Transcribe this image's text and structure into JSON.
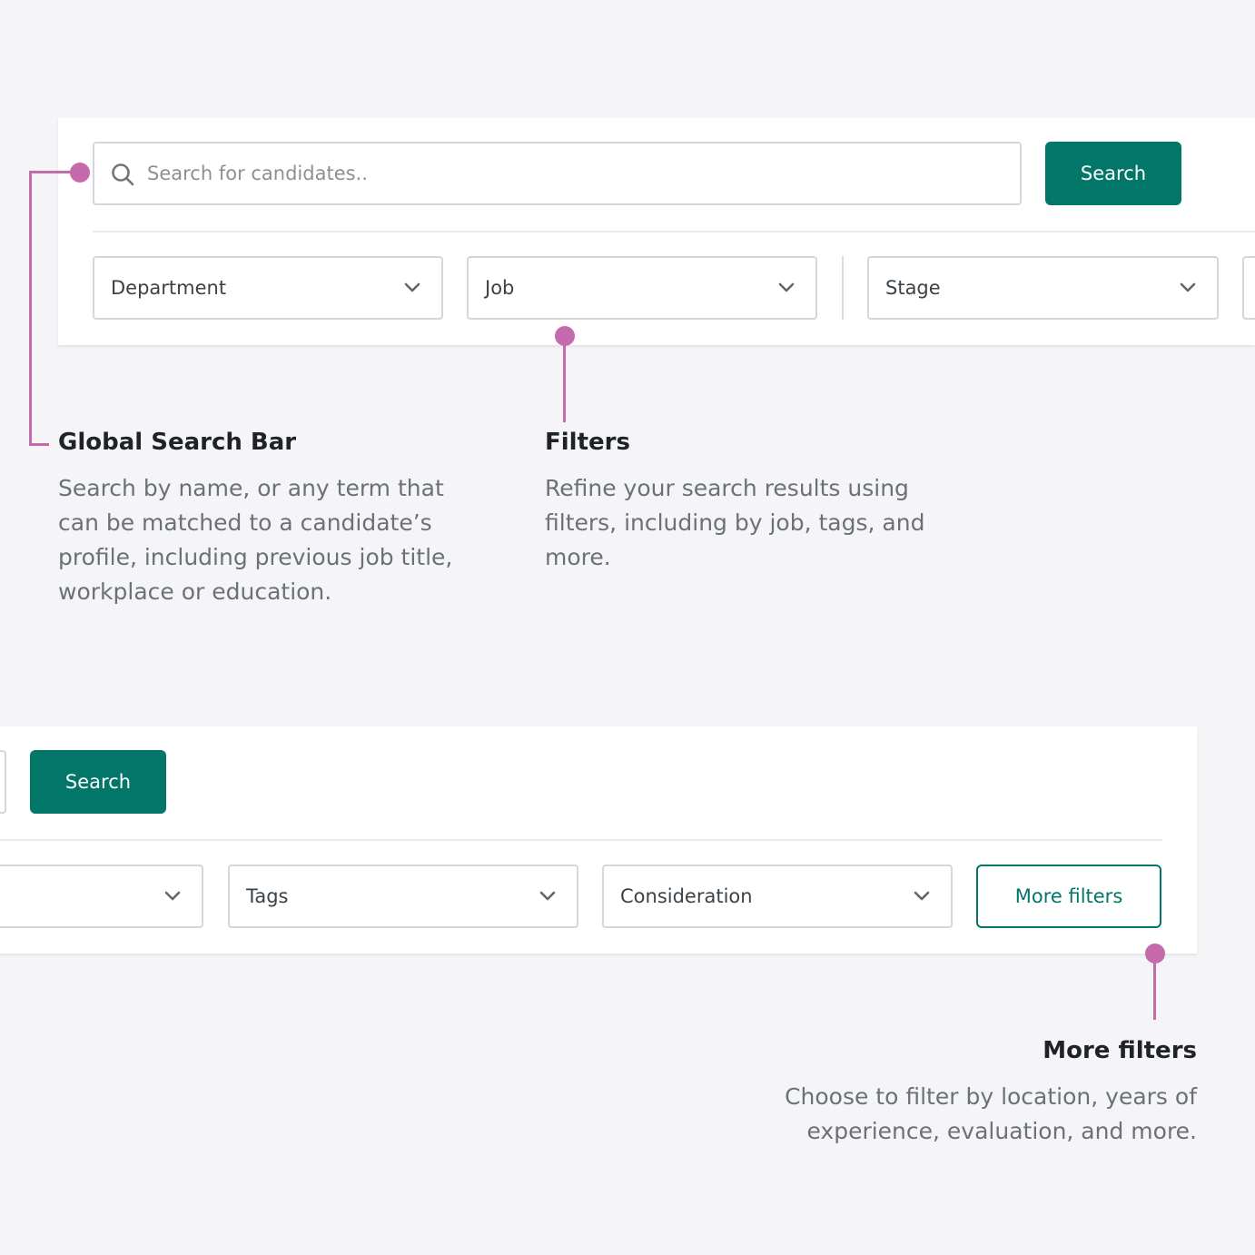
{
  "top_panel": {
    "search_placeholder": "Search for candidates..",
    "search_button": "Search",
    "filters": [
      "Department",
      "Job",
      "Stage"
    ]
  },
  "bottom_panel": {
    "search_button": "Search",
    "filters": [
      "Tags",
      "Consideration"
    ],
    "more_filters_button": "More filters"
  },
  "annotations": {
    "global_search": {
      "title": "Global Search Bar",
      "description": "Search by name, or any term that can be matched to a candidate’s profile, including previous job title, workplace or education."
    },
    "filters": {
      "title": "Filters",
      "description": "Refine your search results using filters, including by job, tags, and more."
    },
    "more_filters": {
      "title": "More filters",
      "description": "Choose to filter by location, years of experience, evaluation, and more."
    }
  },
  "colors": {
    "accent": "#03766a",
    "callout": "#c56aad",
    "background": "#f5f5f7"
  },
  "icons": [
    "search-icon",
    "chevron-down-icon"
  ]
}
